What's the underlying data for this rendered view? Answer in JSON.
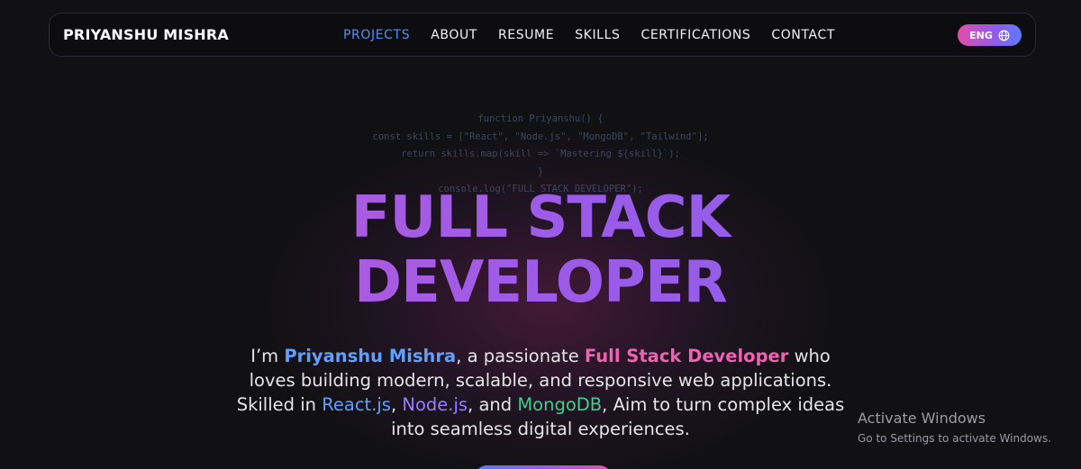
{
  "navbar": {
    "brand": "PRIYANSHU MISHRA",
    "links": [
      {
        "label": "PROJECTS",
        "active": true
      },
      {
        "label": "ABOUT",
        "active": false
      },
      {
        "label": "RESUME",
        "active": false
      },
      {
        "label": "SKILLS",
        "active": false
      },
      {
        "label": "CERTIFICATIONS",
        "active": false
      },
      {
        "label": "CONTACT",
        "active": false
      }
    ],
    "language": {
      "label": "ENG",
      "icon": "globe-icon"
    }
  },
  "code_snippet": [
    "function Priyanshu() {",
    "const skills = [\"React\", \"Node.js\", \"MongoDB\", \"Tailwind\"];",
    "return skills.map(skill => `Mastering ${skill}`);",
    "}",
    "console.log(\"FULL STACK DEVELOPER\");"
  ],
  "hero": {
    "headline_line1": "FULL STACK",
    "headline_line2": "DEVELOPER",
    "intro": {
      "p1": "I’m ",
      "name": "Priyanshu Mishra",
      "p2": ", a passionate ",
      "role": "Full Stack Developer",
      "p3": " who loves building modern, scalable, and responsive web applications. Skilled in ",
      "tech1": "React.js",
      "p4": ", ",
      "tech2": "Node.js",
      "p5": ", and ",
      "tech3": "MongoDB",
      "p6": ", Aim to turn complex ideas into seamless digital experiences."
    }
  },
  "watermark": {
    "title": "Activate Windows",
    "subtitle": "Go to Settings to activate Windows."
  },
  "colors": {
    "background": "#111114",
    "accent_blue": "#4d8ff7",
    "accent_pink": "#f063b3",
    "accent_green": "#3fcf8e",
    "headline_gradient_start": "#c15ad8",
    "headline_gradient_end": "#8a64ee"
  }
}
